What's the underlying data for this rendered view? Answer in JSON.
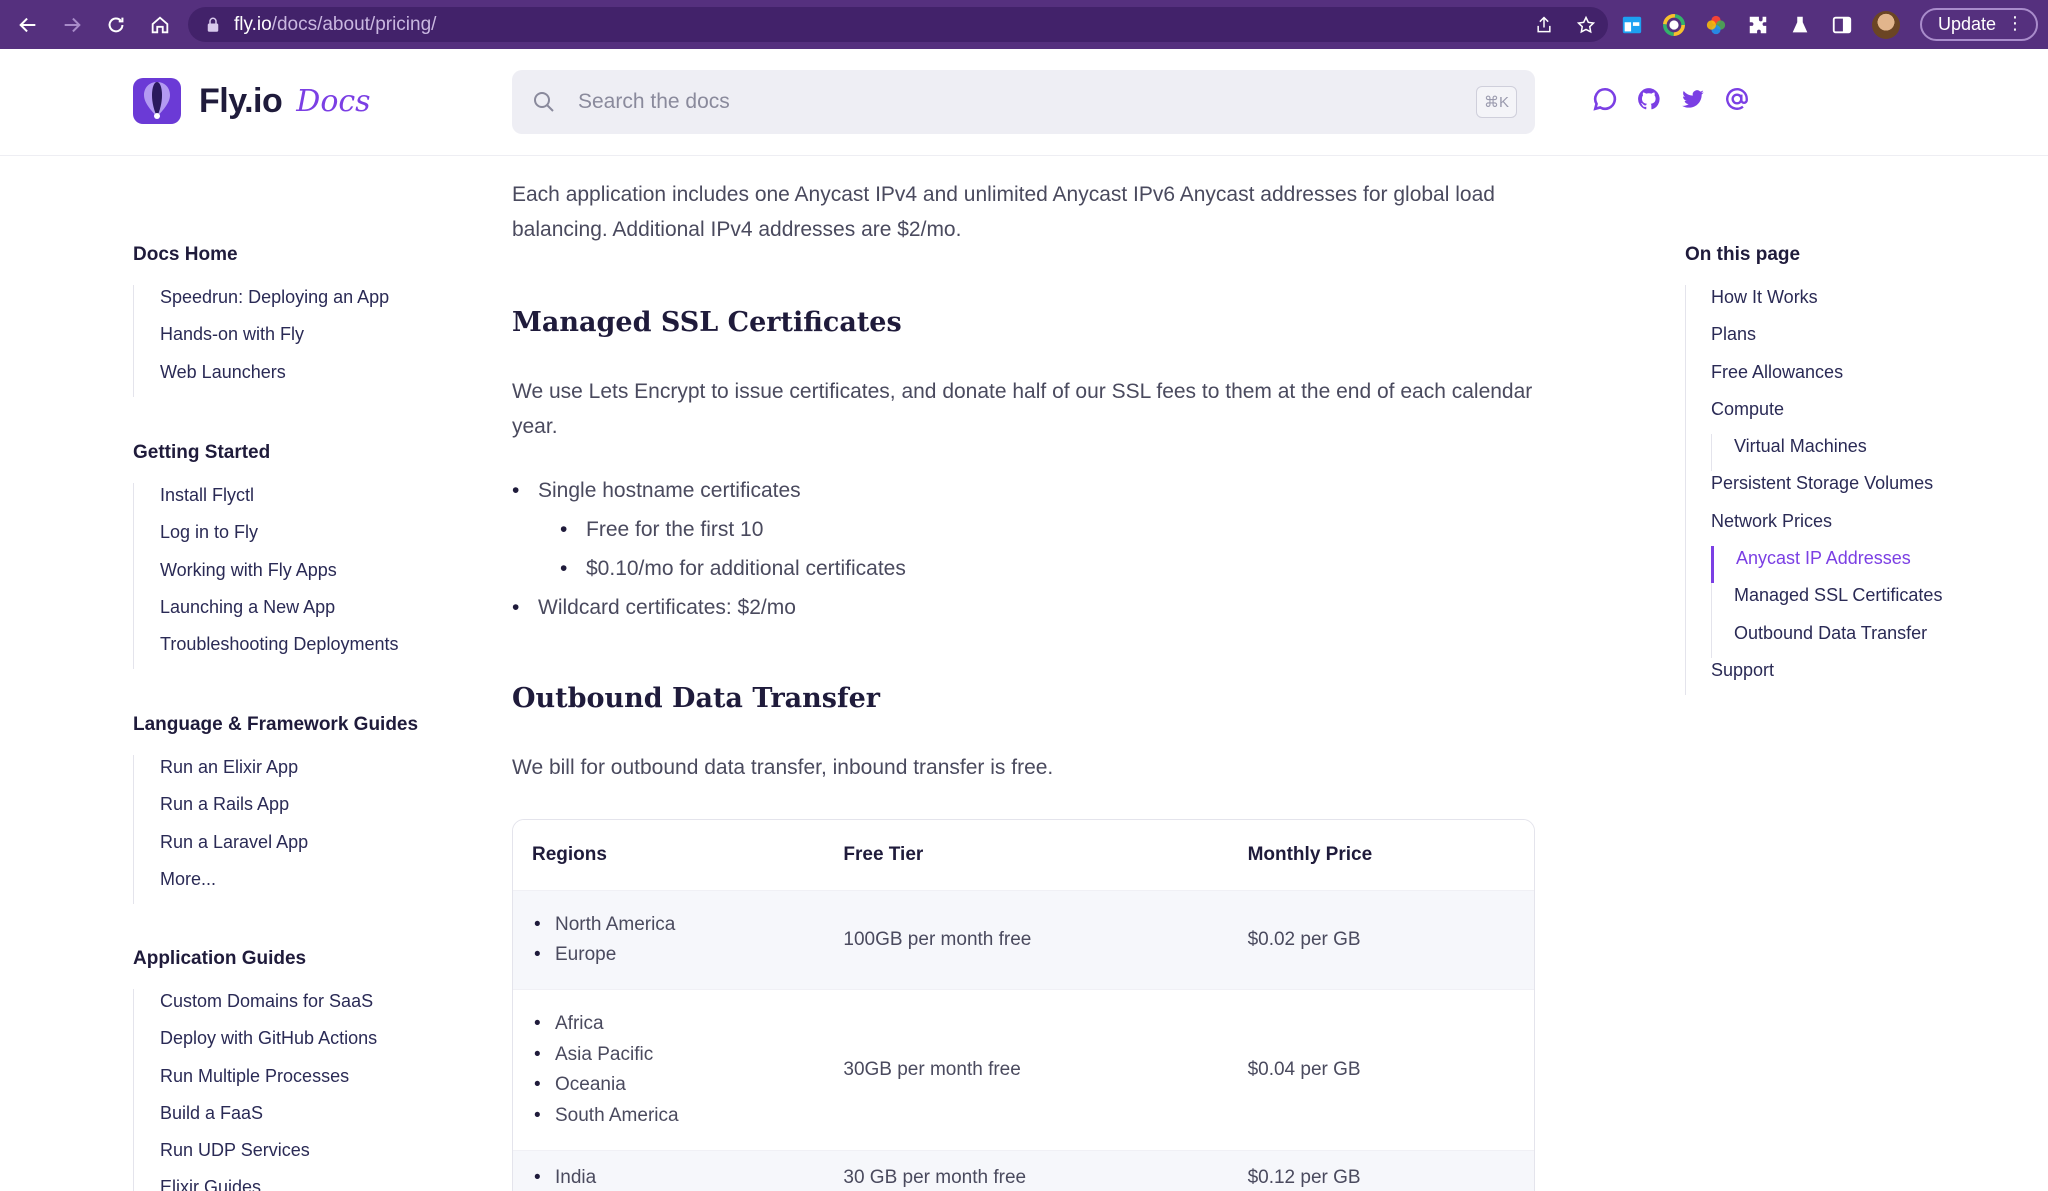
{
  "browser": {
    "url_host": "fly.io",
    "url_path": "/docs/about/pricing/",
    "update_label": "Update"
  },
  "header": {
    "brand": "Fly.io",
    "brand_suffix": "Docs",
    "search_placeholder": "Search the docs",
    "search_shortcut": "⌘K"
  },
  "sidebar": {
    "sections": [
      {
        "title": "Docs Home",
        "items": [
          "Speedrun: Deploying an App",
          "Hands-on with Fly",
          "Web Launchers"
        ]
      },
      {
        "title": "Getting Started",
        "items": [
          "Install Flyctl",
          "Log in to Fly",
          "Working with Fly Apps",
          "Launching a New App",
          "Troubleshooting Deployments"
        ]
      },
      {
        "title": "Language & Framework Guides",
        "items": [
          "Run an Elixir App",
          "Run a Rails App",
          "Run a Laravel App",
          "More..."
        ]
      },
      {
        "title": "Application Guides",
        "items": [
          "Custom Domains for SaaS",
          "Deploy with GitHub Actions",
          "Run Multiple Processes",
          "Build a FaaS",
          "Run UDP Services",
          "Elixir Guides"
        ]
      }
    ]
  },
  "main": {
    "intro": "Each application includes one Anycast IPv4 and unlimited Anycast IPv6 Anycast addresses for global load balancing. Additional IPv4 addresses are $2/mo.",
    "ssl_heading": "Managed SSL Certificates",
    "ssl_text": "We use Lets Encrypt to issue certificates, and donate half of our SSL fees to them at the end of each calendar year.",
    "ssl_bullets": {
      "single": "Single hostname certificates",
      "free": "Free for the first 10",
      "additional": "$0.10/mo for additional certificates",
      "wildcard": "Wildcard certificates: $2/mo"
    },
    "outbound_heading": "Outbound Data Transfer",
    "outbound_text": "We bill for outbound data transfer, inbound transfer is free.",
    "table": {
      "headers": [
        "Regions",
        "Free Tier",
        "Monthly Price"
      ],
      "rows": [
        {
          "regions": [
            "North America",
            "Europe"
          ],
          "free": "100GB per month free",
          "price": "$0.02 per GB"
        },
        {
          "regions": [
            "Africa",
            "Asia Pacific",
            "Oceania",
            "South America"
          ],
          "free": "30GB per month free",
          "price": "$0.04 per GB"
        },
        {
          "regions": [
            "India"
          ],
          "free": "30 GB per month free",
          "price": "$0.12 per GB"
        }
      ]
    }
  },
  "toc": {
    "title": "On this page",
    "items": [
      "How It Works",
      "Plans",
      "Free Allowances",
      "Compute",
      "Virtual Machines",
      "Persistent Storage Volumes",
      "Network Prices",
      "Anycast IP Addresses",
      "Managed SSL Certificates",
      "Outbound Data Transfer",
      "Support"
    ]
  },
  "colors": {
    "browser_frame": "#55307e",
    "accent": "#7b3fe4",
    "heading": "#1f1b3b"
  }
}
